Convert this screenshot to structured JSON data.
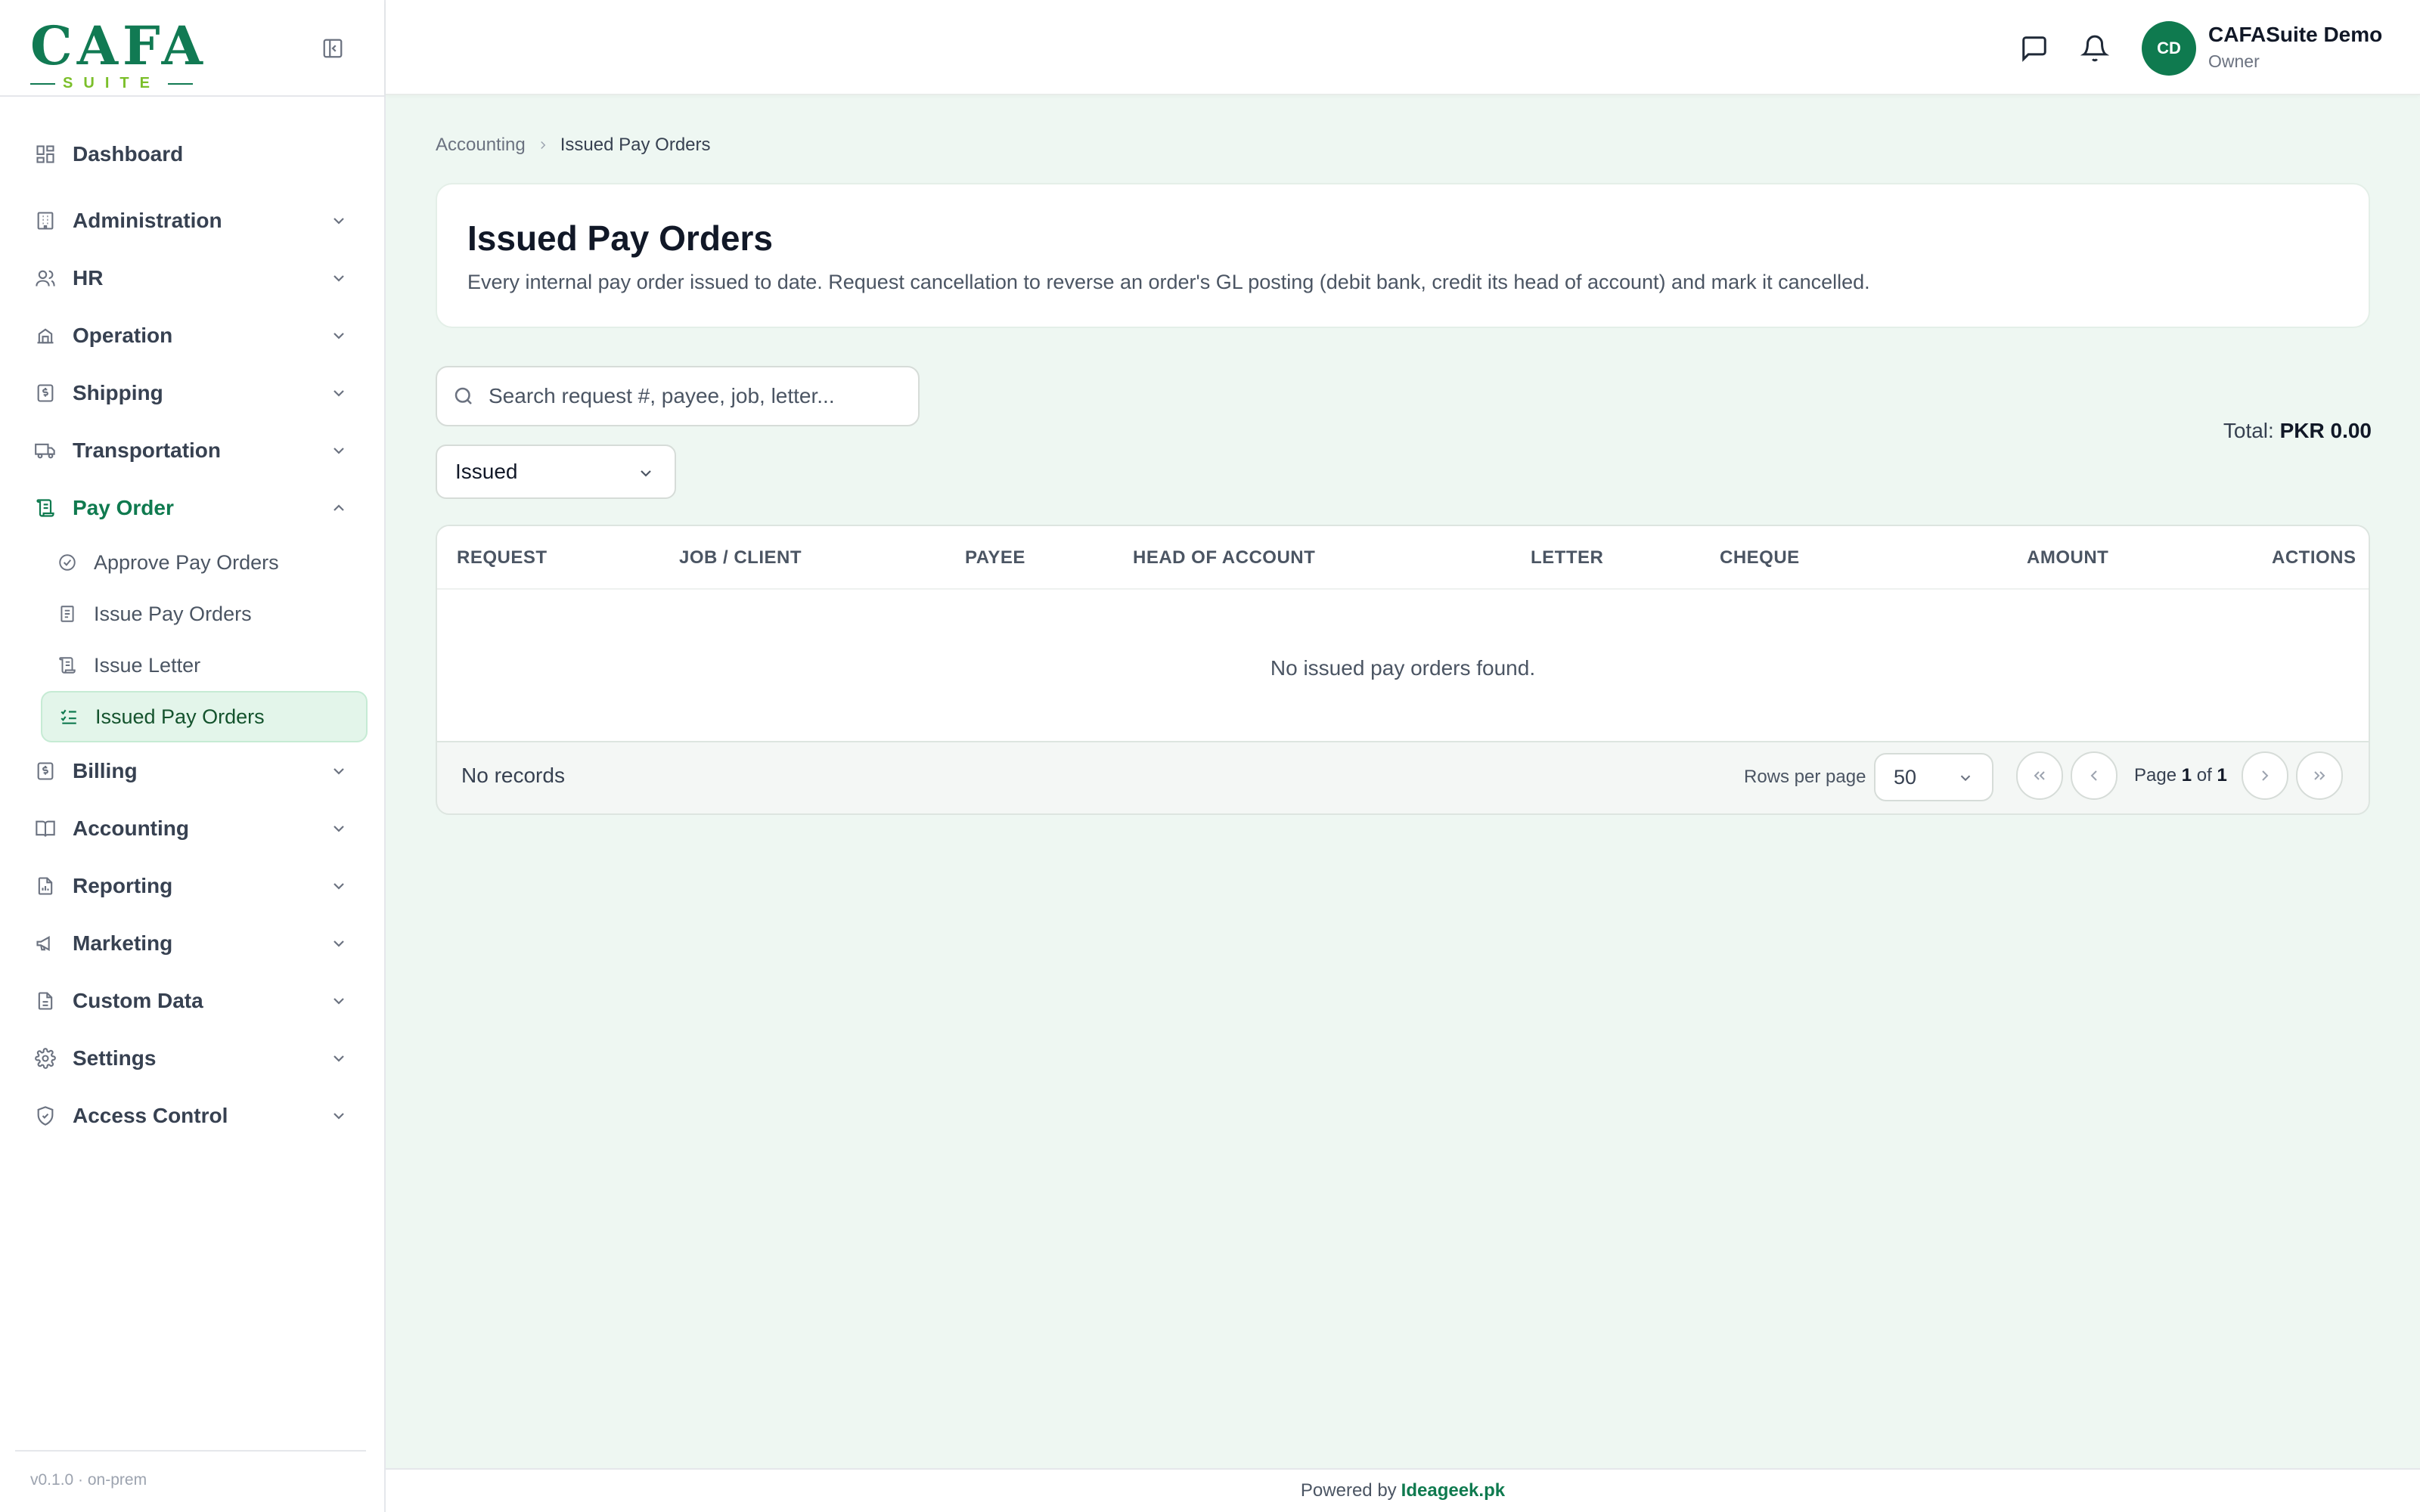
{
  "brand": {
    "logo_text": "CAFA",
    "logo_sub": "SUITE",
    "accent": "#0f7a4f",
    "secondary": "#7bbf2a"
  },
  "sidebar": {
    "items": [
      {
        "label": "Dashboard",
        "icon": "dashboard-icon"
      },
      {
        "label": "Administration",
        "icon": "building-icon"
      },
      {
        "label": "HR",
        "icon": "users-icon"
      },
      {
        "label": "Operation",
        "icon": "operation-icon"
      },
      {
        "label": "Shipping",
        "icon": "shipping-icon"
      },
      {
        "label": "Transportation",
        "icon": "truck-icon"
      },
      {
        "label": "Pay Order",
        "icon": "scroll-icon",
        "expanded": true
      },
      {
        "label": "Billing",
        "icon": "billing-icon"
      },
      {
        "label": "Accounting",
        "icon": "book-icon"
      },
      {
        "label": "Reporting",
        "icon": "report-icon"
      },
      {
        "label": "Marketing",
        "icon": "megaphone-icon"
      },
      {
        "label": "Custom Data",
        "icon": "document-icon"
      },
      {
        "label": "Settings",
        "icon": "gear-icon"
      },
      {
        "label": "Access Control",
        "icon": "shield-icon"
      }
    ],
    "pay_order_subitems": [
      {
        "label": "Approve Pay Orders",
        "icon": "check-circle-icon"
      },
      {
        "label": "Issue Pay Orders",
        "icon": "file-text-icon"
      },
      {
        "label": "Issue Letter",
        "icon": "scroll-icon"
      },
      {
        "label": "Issued Pay Orders",
        "icon": "list-checks-icon",
        "active": true
      }
    ],
    "version": "v0.1.0 · on-prem"
  },
  "topbar": {
    "user": {
      "initials": "CD",
      "name": "CAFASuite Demo",
      "role": "Owner"
    }
  },
  "breadcrumb": {
    "parent": "Accounting",
    "current": "Issued Pay Orders"
  },
  "page": {
    "title": "Issued Pay Orders",
    "description": "Every internal pay order issued to date. Request cancellation to reverse an order's GL posting (debit bank, credit its head of account) and mark it cancelled."
  },
  "filters": {
    "search_placeholder": "Search request #, payee, job, letter...",
    "status_selected": "Issued"
  },
  "total": {
    "label": "Total:",
    "value": "PKR 0.00"
  },
  "table": {
    "columns": [
      "REQUEST",
      "JOB / CLIENT",
      "PAYEE",
      "HEAD OF ACCOUNT",
      "LETTER",
      "CHEQUE",
      "AMOUNT",
      "ACTIONS"
    ],
    "rows": [],
    "empty_message": "No issued pay orders found."
  },
  "pagination": {
    "records_label": "No records",
    "rows_per_page_label": "Rows per page",
    "rows_per_page": "50",
    "page_word": "Page",
    "current": "1",
    "of_word": "of",
    "total": "1"
  },
  "footer": {
    "prefix": "Powered by",
    "link": "Ideageek.pk"
  }
}
